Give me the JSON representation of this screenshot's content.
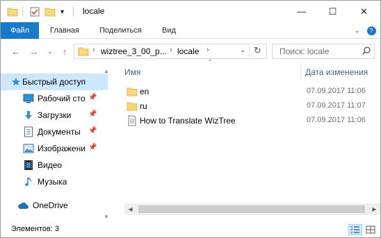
{
  "window": {
    "title": "locale",
    "minimize_glyph": "—",
    "maximize_glyph": "☐",
    "close_glyph": "✕"
  },
  "ribbon": {
    "tabs": [
      {
        "label": "Файл",
        "active": true
      },
      {
        "label": "Главная"
      },
      {
        "label": "Поделиться"
      },
      {
        "label": "Вид"
      }
    ],
    "collapse_glyph": "⌄",
    "help_glyph": "?"
  },
  "address": {
    "back_glyph": "←",
    "forward_glyph": "→",
    "recent_glyph": "⌄",
    "up_glyph": "↑",
    "crumbs": [
      "wiztree_3_00_p...",
      "locale"
    ],
    "separator": "›",
    "dropdown_glyph": "⌄",
    "refresh_glyph": "↻"
  },
  "search": {
    "placeholder": "Поиск: locale",
    "icon_glyph": "⚲"
  },
  "navpane": {
    "items": [
      {
        "label": "Быстрый доступ",
        "icon": "star-icon",
        "selected": true
      },
      {
        "label": "Рабочий сто.",
        "icon": "desktop-icon",
        "pinned": true
      },
      {
        "label": "Загрузки",
        "icon": "download-icon",
        "pinned": true
      },
      {
        "label": "Документы",
        "icon": "document-icon",
        "pinned": true
      },
      {
        "label": "Изображени",
        "icon": "pictures-icon",
        "pinned": true
      },
      {
        "label": "Видео",
        "icon": "video-icon"
      },
      {
        "label": "Музыка",
        "icon": "music-icon"
      },
      {
        "label": "OneDrive",
        "icon": "cloud-icon"
      }
    ],
    "pin_glyph": "📌"
  },
  "content": {
    "columns": {
      "name": "Имя",
      "date": "Дата изменения"
    },
    "files": [
      {
        "name": "en",
        "type": "folder",
        "date": "07.09.2017 11:06"
      },
      {
        "name": "ru",
        "type": "folder",
        "date": "07.09.2017 11:07"
      },
      {
        "name": "How to Translate WizTree",
        "type": "text",
        "date": "07.09.2017 11:06"
      }
    ]
  },
  "status": {
    "text": "Элементов: 3"
  },
  "colors": {
    "accent": "#1979ca",
    "selection": "#cce8ff",
    "folder": "#f8d775"
  }
}
